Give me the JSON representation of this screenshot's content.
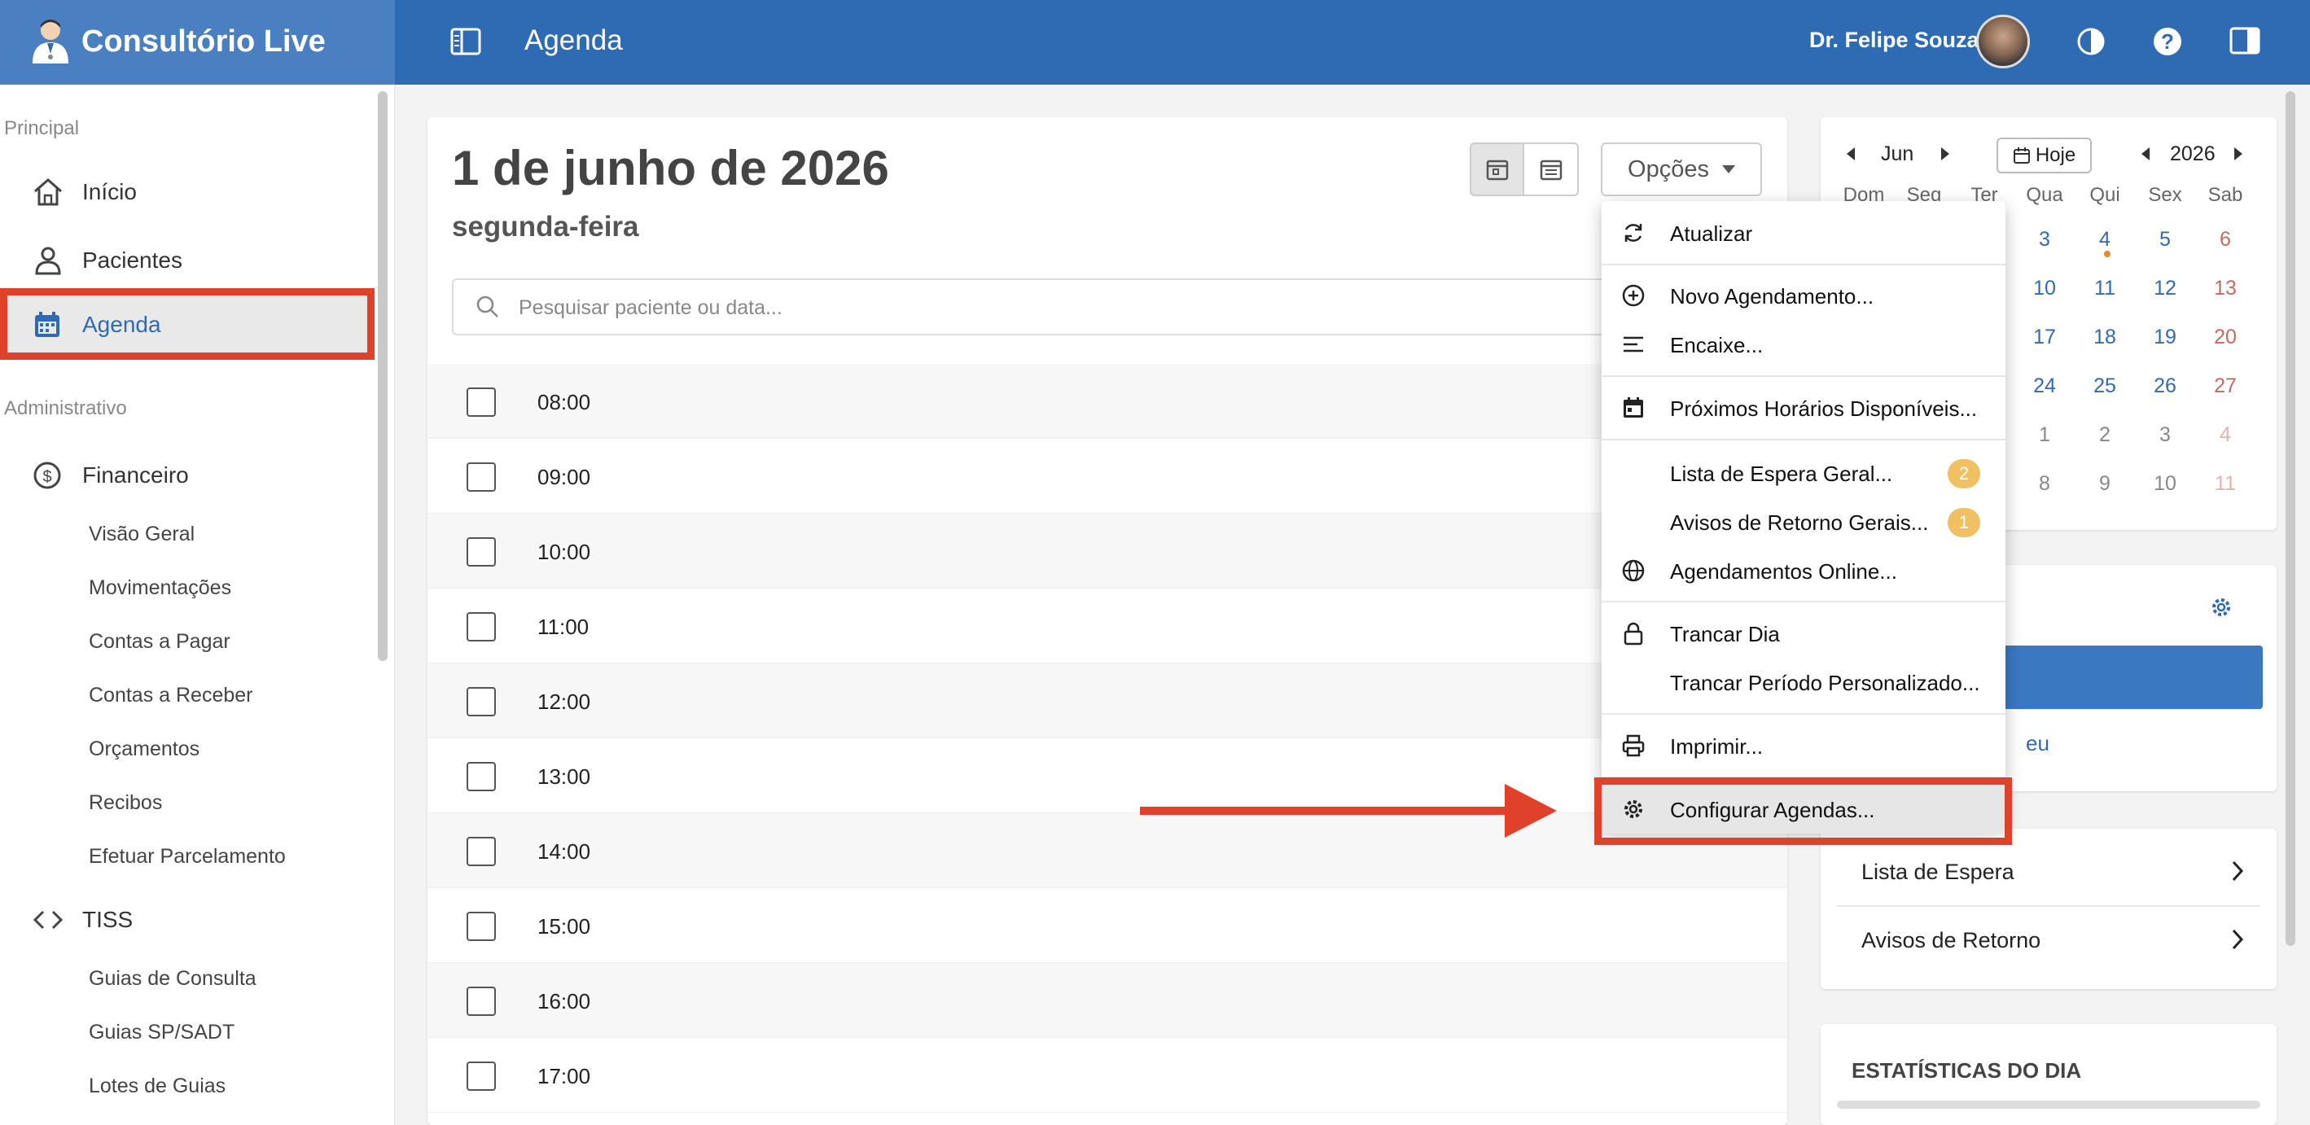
{
  "app": {
    "name": "Consultório Live",
    "page_title": "Agenda"
  },
  "user": {
    "name": "Dr. Felipe Souza"
  },
  "sidebar": {
    "section_principal": "Principal",
    "inicio": "Início",
    "pacientes": "Pacientes",
    "agenda": "Agenda",
    "section_admin": "Administrativo",
    "financeiro": "Financeiro",
    "financeiro_items": [
      "Visão Geral",
      "Movimentações",
      "Contas a Pagar",
      "Contas a Receber",
      "Orçamentos",
      "Recibos",
      "Efetuar Parcelamento"
    ],
    "tiss": "TISS",
    "tiss_items": [
      "Guias de Consulta",
      "Guias SP/SADT",
      "Lotes de Guias"
    ]
  },
  "agenda": {
    "date": "1 de junho de 2026",
    "weekday": "segunda-feira",
    "options_label": "Opções",
    "search_placeholder": "Pesquisar paciente ou data...",
    "slots": [
      "08:00",
      "09:00",
      "10:00",
      "11:00",
      "12:00",
      "13:00",
      "14:00",
      "15:00",
      "16:00",
      "17:00"
    ]
  },
  "options_menu": {
    "atualizar": "Atualizar",
    "novo": "Novo Agendamento...",
    "encaixe": "Encaixe...",
    "proximos": "Próximos Horários Disponíveis...",
    "lista_espera_geral": "Lista de Espera Geral...",
    "lista_espera_count": "2",
    "avisos_retorno_gerais": "Avisos de Retorno Gerais...",
    "avisos_retorno_count": "1",
    "online": "Agendamentos Online...",
    "trancar_dia": "Trancar Dia",
    "trancar_periodo": "Trancar Período Personalizado...",
    "imprimir": "Imprimir...",
    "configurar": "Configurar Agendas..."
  },
  "calendar": {
    "month": "Jun",
    "year": "2026",
    "today_label": "Hoje",
    "weekdays": [
      "Dom",
      "Seg",
      "Ter",
      "Qua",
      "Qui",
      "Sex",
      "Sab"
    ],
    "visible_weekdays": [
      "Qua",
      "Qui",
      "Sex",
      "Sab"
    ],
    "rows": [
      [
        "3",
        "4",
        "5",
        "6"
      ],
      [
        "10",
        "11",
        "12",
        "13"
      ],
      [
        "17",
        "18",
        "19",
        "20"
      ],
      [
        "24",
        "25",
        "26",
        "27"
      ],
      [
        "1",
        "2",
        "3",
        "4"
      ],
      [
        "8",
        "9",
        "10",
        "11"
      ]
    ]
  },
  "panel": {
    "partial_link": "eu",
    "lista_espera": "Lista de Espera",
    "avisos_retorno": "Avisos de Retorno",
    "estatisticas": "ESTATÍSTICAS DO DIA"
  },
  "colors": {
    "primary": "#2f6bb3",
    "brand_bg": "#4a80c1",
    "highlight": "#e0412a",
    "badge": "#f0c062",
    "weekend": "#c0392b"
  }
}
